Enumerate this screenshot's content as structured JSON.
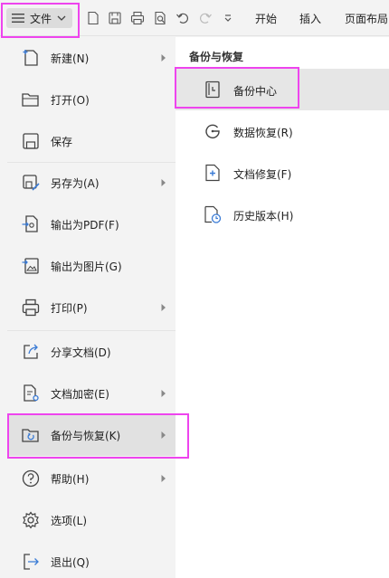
{
  "toolbar": {
    "file_menu_label": "文件",
    "tabs": [
      "开始",
      "插入",
      "页面布局"
    ]
  },
  "menu": {
    "items": [
      {
        "label": "新建(N)",
        "icon": "new-document-icon",
        "has_submenu": true
      },
      {
        "label": "打开(O)",
        "icon": "folder-open-icon",
        "has_submenu": false
      },
      {
        "label": "保存",
        "icon": "save-icon",
        "has_submenu": false
      },
      {
        "label": "另存为(A)",
        "icon": "save-as-icon",
        "has_submenu": true
      },
      {
        "label": "输出为PDF(F)",
        "icon": "export-pdf-icon",
        "has_submenu": false
      },
      {
        "label": "输出为图片(G)",
        "icon": "export-image-icon",
        "has_submenu": false
      },
      {
        "label": "打印(P)",
        "icon": "printer-icon",
        "has_submenu": true
      },
      {
        "label": "分享文档(D)",
        "icon": "share-icon",
        "has_submenu": false
      },
      {
        "label": "文档加密(E)",
        "icon": "encrypt-document-icon",
        "has_submenu": true
      },
      {
        "label": "备份与恢复(K)",
        "icon": "backup-restore-icon",
        "has_submenu": true,
        "active": true
      },
      {
        "label": "帮助(H)",
        "icon": "help-icon",
        "has_submenu": true
      },
      {
        "label": "选项(L)",
        "icon": "gear-icon",
        "has_submenu": false
      },
      {
        "label": "退出(Q)",
        "icon": "exit-icon",
        "has_submenu": false
      }
    ]
  },
  "submenu": {
    "title": "备份与恢复",
    "items": [
      {
        "label": "备份中心",
        "icon": "backup-center-icon",
        "active": true
      },
      {
        "label": "数据恢复(R)",
        "icon": "data-recovery-icon"
      },
      {
        "label": "文档修复(F)",
        "icon": "document-repair-icon"
      },
      {
        "label": "历史版本(H)",
        "icon": "history-version-icon"
      }
    ]
  },
  "colors": {
    "highlight": "#ee44ee",
    "accent_blue": "#3a7bd5",
    "menu_bg": "#f3f3f3",
    "panel_bg": "#ffffff"
  }
}
